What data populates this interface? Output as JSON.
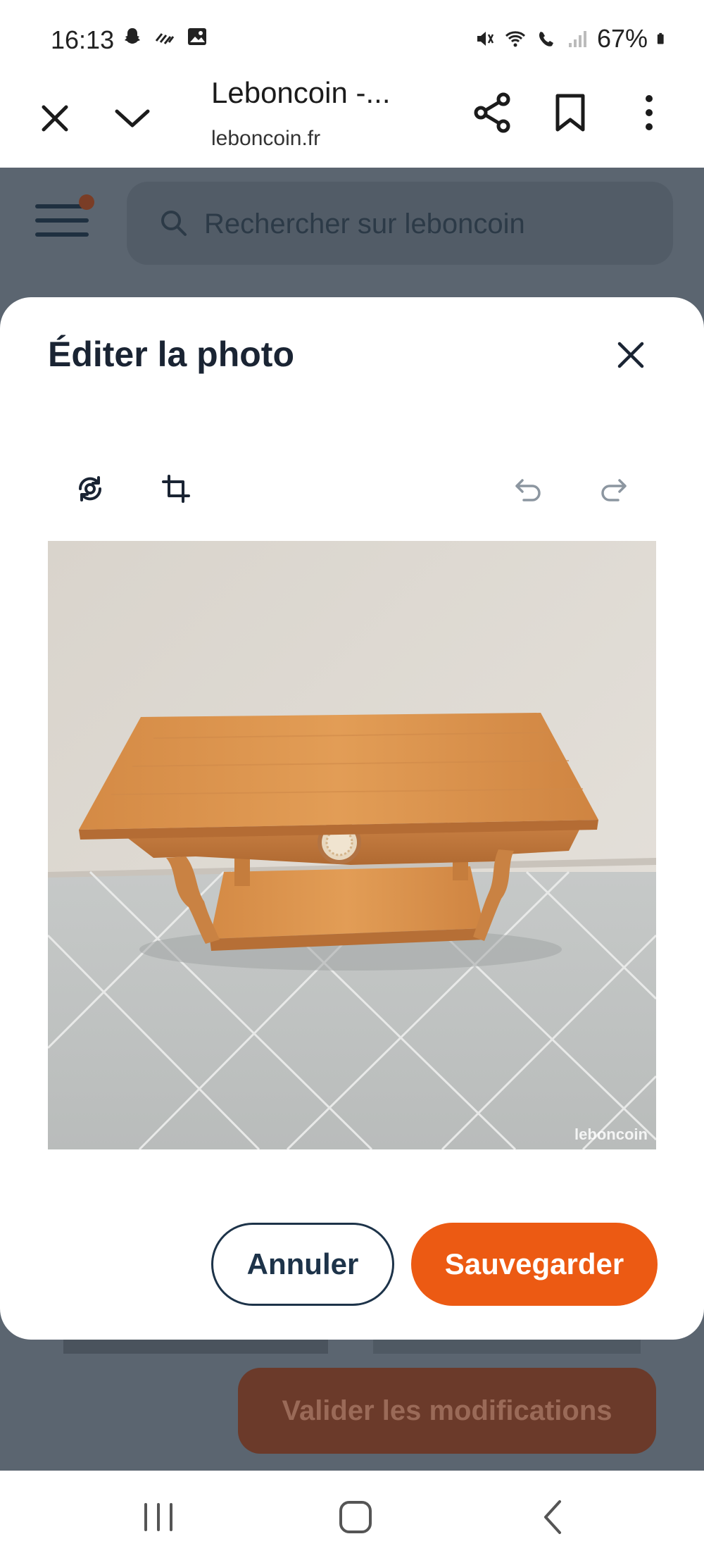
{
  "status_bar": {
    "time": "16:13",
    "battery": "67%",
    "left_icons": [
      "snapchat-icon",
      "signal-waves-icon",
      "gallery-icon"
    ],
    "right_icons": [
      "mute-vibrate-icon",
      "wifi-call-icon",
      "volte-icon",
      "cell-signal-icon",
      "battery-icon"
    ]
  },
  "browser": {
    "title": "Leboncoin -...",
    "url": "leboncoin.fr",
    "icons": [
      "close-icon",
      "chevron-down-icon",
      "share-icon",
      "bookmark-icon",
      "more-vert-icon"
    ]
  },
  "site_header": {
    "search_placeholder": "Rechercher sur leboncoin"
  },
  "modal": {
    "title": "Éditer la photo",
    "tools": [
      "rotate-icon",
      "crop-icon",
      "undo-icon",
      "redo-icon"
    ],
    "photo_watermark": "leboncoin",
    "cancel_label": "Annuler",
    "save_label": "Sauvegarder"
  },
  "background_page": {
    "validate_label": "Valider les modifications"
  },
  "colors": {
    "accent": "#ec5a13",
    "dark_blue": "#1d3349",
    "overlay": "#5b6570"
  },
  "navbar": {
    "icons": [
      "recent-apps-icon",
      "home-icon",
      "back-icon"
    ]
  }
}
